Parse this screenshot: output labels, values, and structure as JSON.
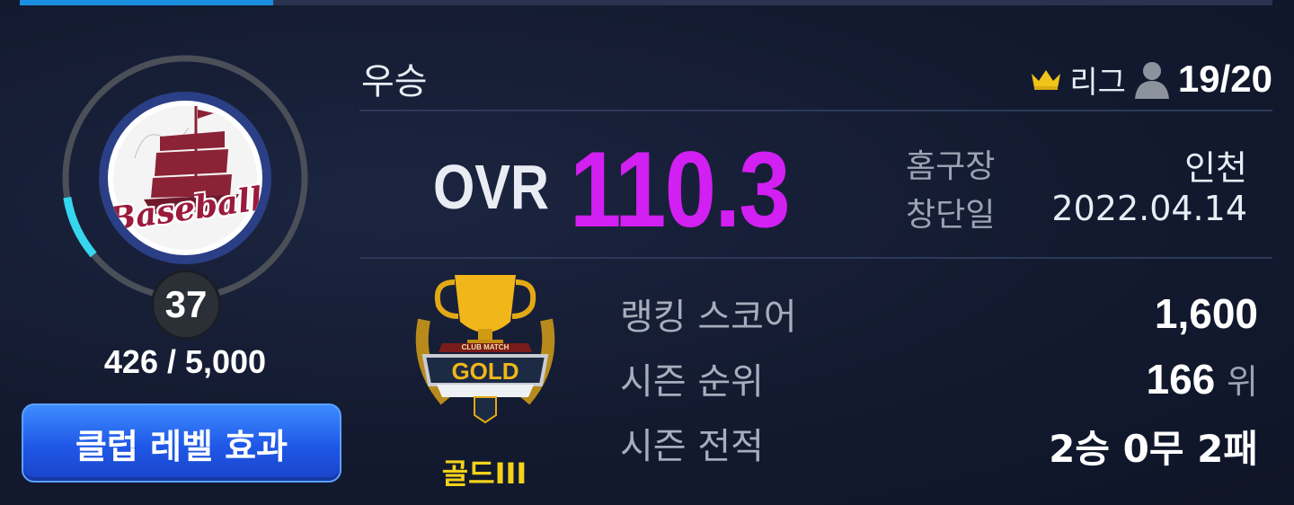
{
  "club": {
    "emblem_text": "Baseball",
    "level": "37",
    "level_progress": 0.085,
    "xp": "426 / 5,000",
    "level_effect_button": "클럽 레벨 효과"
  },
  "header": {
    "club_name": "우승",
    "league_label": "리그",
    "member_count": "19/20",
    "icons": [
      "crown-icon",
      "person-icon"
    ]
  },
  "ovr": {
    "label": "OVR",
    "value": "110.3"
  },
  "info": {
    "stadium_label": "홈구장",
    "stadium_value": "인천",
    "founded_label": "창단일",
    "founded_value": "2022.04.14"
  },
  "tier": {
    "badge_text_top": "CLUB MATCH",
    "badge_text": "GOLD",
    "name": "골드III"
  },
  "stats": {
    "ranking_score_label": "랭킹 스코어",
    "ranking_score_value": "1,600",
    "season_rank_label": "시즌 순위",
    "season_rank_value": "166",
    "season_rank_unit": "위",
    "season_record_label": "시즌 전적",
    "season_record_value": "2승 0무 2패"
  },
  "colors": {
    "ovr": "#d21ff2",
    "tier": "#f3d21a",
    "level_ring": "#35d6ee",
    "button": "#1f57e6"
  }
}
